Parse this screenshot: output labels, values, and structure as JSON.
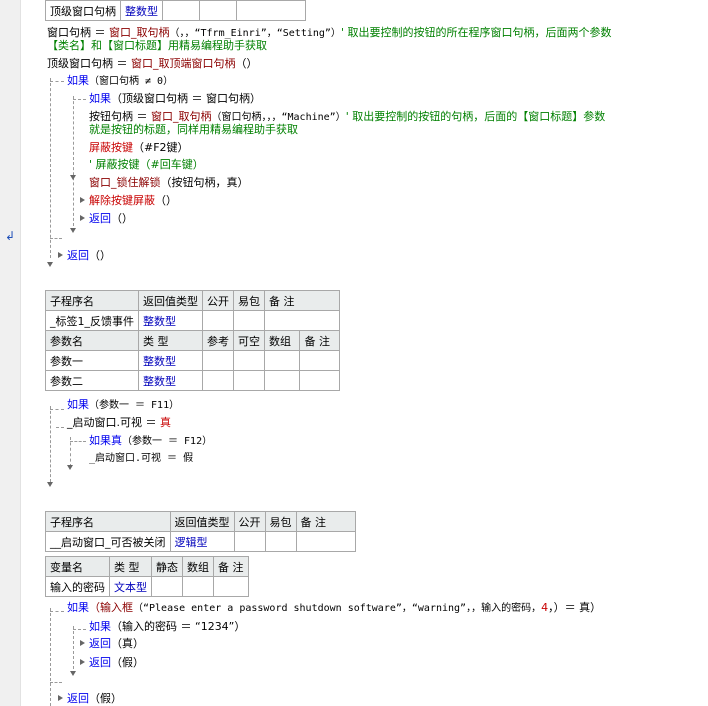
{
  "table0": {
    "r0c0": "顶级窗口句柄",
    "r0c1": "整数型"
  },
  "code1": {
    "l1_a": "窗口句柄 ＝ ",
    "l1_fn": "窗口_取句柄",
    "l1_b": "（，，“Tfrm_Einri”，“Setting”）",
    "l1_cm": "' 取出要控制的按钮的所在程序窗口句柄，后面两个参数",
    "l1_cm2": "【类名】和【窗口标题】用精易编程助手获取",
    "l2_a": "顶级窗口句柄 ＝ ",
    "l2_fn": "窗口_取顶端窗口句柄",
    "l2_b": "（）",
    "if1_kw": "如果",
    "if1_b": "（窗口句柄 ≠ 0）",
    "if2_kw": "如果",
    "if2_b": "（顶级窗口句柄 ＝ 窗口句柄）",
    "l3_a": "按钮句柄 ＝ ",
    "l3_fn": "窗口_取句柄",
    "l3_b": "（窗口句柄，，，“Machine”）",
    "l3_cm": "' 取出要控制的按钮的句柄，后面的【窗口标题】参数",
    "l3_cm2": "就是按钮的标题，同样用精易编程助手获取",
    "l4_fn": "屏蔽按键",
    "l4_b": "（#F2键）",
    "l5_cm": "' 屏蔽按键（#回车键）",
    "l6_fn": "窗口_锁住解锁",
    "l6_b": "（按钮句柄，真）",
    "l7_fn": "解除按键屏蔽",
    "l7_b": "（）",
    "l8_kw": "返回",
    "l8_b": "（）",
    "l9_kw": "返回",
    "l9_b": "（）"
  },
  "table1": {
    "h": [
      "子程序名",
      "返回值类型",
      "公开",
      "易包",
      "备 注"
    ],
    "name": "_标签1_反馈事件",
    "ret": "整数型",
    "ph": [
      "参数名",
      "类 型",
      "参考",
      "可空",
      "数组",
      "备 注"
    ],
    "p1_name": "参数一",
    "p1_type": "整数型",
    "p2_name": "参数二",
    "p2_type": "整数型"
  },
  "code2": {
    "if1_kw": "如果",
    "if1_b": "（参数一 ＝ F11）",
    "l1": "_启动窗口.可视 ＝ ",
    "l1_v": "真",
    "if2_kw": "如果真",
    "if2_b": "（参数一 ＝ F12）",
    "l2": "_启动窗口.可视 ＝ 假"
  },
  "table2": {
    "h": [
      "子程序名",
      "返回值类型",
      "公开",
      "易包",
      "备 注"
    ],
    "name": "__启动窗口_可否被关闭",
    "ret": "逻辑型",
    "vh": [
      "变量名",
      "类 型",
      "静态",
      "数组",
      "备 注"
    ],
    "v1_name": "输入的密码",
    "v1_type": "文本型"
  },
  "code3": {
    "if1_kw": "如果",
    "if1_fn": "（输入框",
    "if1_b": "（“Please enter a password shutdown software”，“warning”，，输入的密码，",
    "if1_num": "4",
    "if1_c": "，）＝ 真）",
    "if2_kw": "如果",
    "if2_b": "（输入的密码 ＝ “1234”）",
    "r1_kw": "返回",
    "r1_b": "（真）",
    "r2_kw": "返回",
    "r2_b": "（假）",
    "r3_kw": "返回",
    "r3_b": "（假）"
  }
}
